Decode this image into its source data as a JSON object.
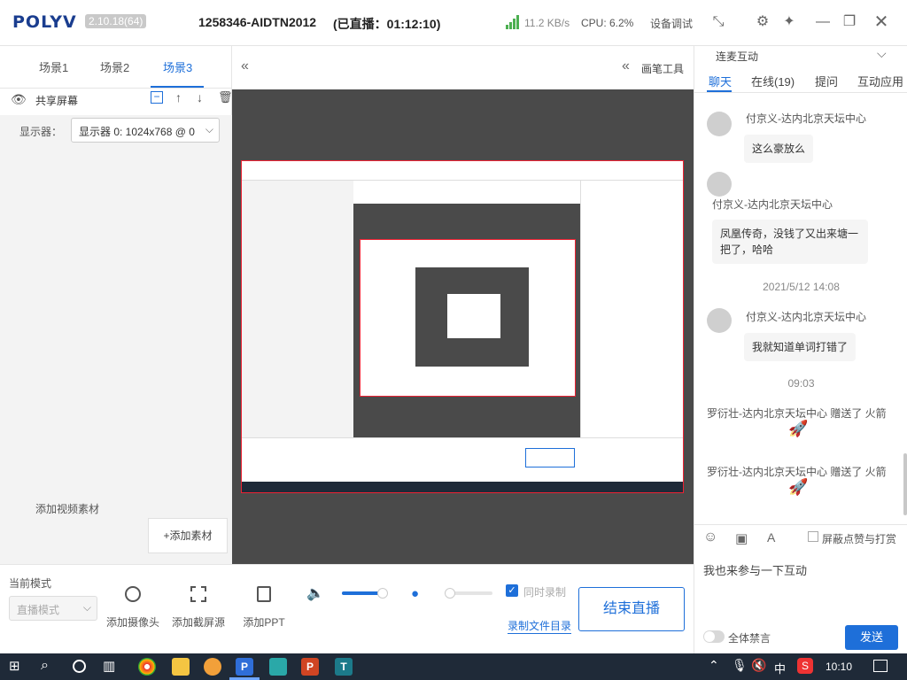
{
  "app": {
    "brand": "POLYV",
    "version": "2.10.18(64)",
    "room_id": "1258346-AIDTN2012",
    "live_status": "(已直播：01:12:10)",
    "speed": "11.2 KB/s",
    "cpu": "CPU: 6.2%",
    "device_test": "设备调试"
  },
  "scenes": [
    "场景1",
    "场景2",
    "场景3"
  ],
  "source": {
    "label": "共享屏幕",
    "display_label": "显示器：",
    "display_value": "显示器 0: 1024x768 @ 0"
  },
  "canvas": {
    "draw_tools": "画笔工具"
  },
  "left_footer": {
    "add_video_material": "添加视频素材",
    "add_material": "+添加素材"
  },
  "bottom": {
    "mode_label": "当前模式",
    "mode_value": "直播模式",
    "tools": [
      "添加摄像头",
      "添加截屏源",
      "添加PPT"
    ],
    "sync_record": "同时录制",
    "record_dir": "录制文件目录",
    "end_live": "结束直播"
  },
  "right": {
    "header": "连麦互动",
    "tabs": [
      "聊天",
      "在线(19)",
      "提问",
      "互动应用"
    ],
    "messages": [
      {
        "user": "付京义-达内北京天坛中心",
        "text": "这么豪放么"
      },
      {
        "user": "付京义-达内北京天坛中心",
        "text": "凤凰传奇，没钱了又出来塘一把了，哈哈"
      },
      {
        "time": "2021/5/12 14:08"
      },
      {
        "user": "付京义-达内北京天坛中心",
        "text": "我就知道单词打错了"
      },
      {
        "time": "09:03"
      },
      {
        "gift": "罗衍壮-达内北京天坛中心 赠送了 火箭"
      },
      {
        "gift": "罗衍壮-达内北京天坛中心 赠送了 火箭"
      }
    ],
    "mask_label": "屏蔽点赞与打赏",
    "input_value": "我也来参与一下互动",
    "mute_all": "全体禁言",
    "send": "发送"
  },
  "taskbar": {
    "ime": "中",
    "clock": "10:10"
  },
  "colors": {
    "accent": "#1e6fd9",
    "brand": "#1a3d8f",
    "stage": "#4a4a4a"
  }
}
